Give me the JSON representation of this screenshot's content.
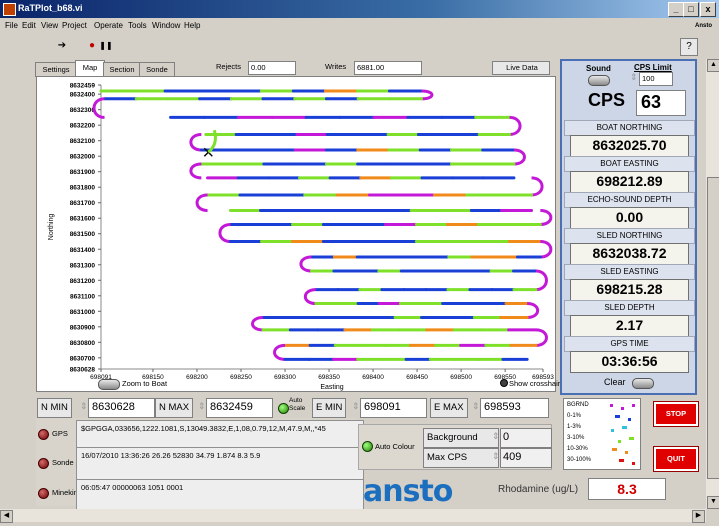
{
  "window": {
    "title": "RaTPlot_b68.vi",
    "min_glyph": "_",
    "max_glyph": "□",
    "close_glyph": "x"
  },
  "menu": {
    "file": "File",
    "edit": "Edit",
    "view": "View",
    "project": "Project",
    "operate": "Operate",
    "tools": "Tools",
    "window": "Window",
    "help": "Help",
    "right_label": "Ansto"
  },
  "toolbar": {
    "run_glyph": "➔",
    "stop_glyph": "●",
    "pause_glyph": "❚❚",
    "help_glyph": "?"
  },
  "tabs": [
    "Settings",
    "Map",
    "Section",
    "Sonde"
  ],
  "tab_active": 1,
  "top_fields": {
    "rejects_label": "Rejects",
    "rejects_value": "0.00",
    "writes_label": "Writes",
    "writes_value": "6881.00",
    "live_data": "Live Data"
  },
  "chart_data": {
    "type": "scatter",
    "ylabel": "Northing",
    "xlabel": "Easting",
    "xlim": [
      698091,
      698593
    ],
    "ylim": [
      8630628,
      8632459
    ],
    "x_ticks": [
      "698091",
      "698150",
      "698200",
      "698250",
      "698300",
      "698350",
      "698400",
      "698450",
      "698500",
      "698550",
      "698593"
    ],
    "y_ticks": [
      "8632459",
      "8632400",
      "8632300",
      "8632200",
      "8632100",
      "8632000",
      "8631900",
      "8631800",
      "8631700",
      "8631600",
      "8631500",
      "8631400",
      "8631300",
      "8631200",
      "8631100",
      "8631000",
      "8630900",
      "8630800",
      "8630700",
      "8630628"
    ],
    "color_scale": [
      "#1a3fd6",
      "#7fe02a",
      "#f08a1a",
      "#c418d8"
    ],
    "track_rows": [
      {
        "y": 8632420,
        "x0": 698091,
        "x1": 698455
      },
      {
        "y": 8632370,
        "x0": 698095,
        "x1": 698455
      },
      {
        "y": 8632250,
        "x0": 698170,
        "x1": 698555
      },
      {
        "y": 8632140,
        "x0": 698210,
        "x1": 698555
      },
      {
        "y": 8632040,
        "x0": 698205,
        "x1": 698560
      },
      {
        "y": 8631950,
        "x0": 698205,
        "x1": 698560
      },
      {
        "y": 8631860,
        "x0": 698212,
        "x1": 698560
      },
      {
        "y": 8631750,
        "x0": 698212,
        "x1": 698580
      },
      {
        "y": 8631650,
        "x0": 698238,
        "x1": 698580
      },
      {
        "y": 8631560,
        "x0": 698238,
        "x1": 698590
      },
      {
        "y": 8631450,
        "x0": 698238,
        "x1": 698590
      },
      {
        "y": 8631350,
        "x0": 698330,
        "x1": 698590
      },
      {
        "y": 8631260,
        "x0": 698330,
        "x1": 698585
      },
      {
        "y": 8631140,
        "x0": 698335,
        "x1": 698585
      },
      {
        "y": 8631050,
        "x0": 698335,
        "x1": 698575
      },
      {
        "y": 8630960,
        "x0": 698275,
        "x1": 698575
      },
      {
        "y": 8630880,
        "x0": 698275,
        "x1": 698585
      },
      {
        "y": 8630780,
        "x0": 698300,
        "x1": 698585
      },
      {
        "y": 8630690,
        "x0": 698300,
        "x1": 698575
      }
    ],
    "boat_position": {
      "x": 698212.89,
      "y": 8632025.7
    },
    "zoom_to_boat": "Zoom to Boat",
    "show_crosshair": "Show crosshair"
  },
  "limits": {
    "nmin_label": "N MIN",
    "nmin": "8630628",
    "nmax_label": "N MAX",
    "nmax": "8632459",
    "auto_scale": "Auto\nScale",
    "emin_label": "E MIN",
    "emin": "698091",
    "emax_label": "E MAX",
    "emax": "698593"
  },
  "right_panel": {
    "sound_label": "Sound",
    "cps_limit_label": "CPS Limit",
    "cps_limit_value": "100",
    "cps_label": "CPS",
    "cps_value": "63",
    "boat_northing_label": "BOAT NORTHING",
    "boat_northing": "8632025.70",
    "boat_easting_label": "BOAT EASTING",
    "boat_easting": "698212.89",
    "echo_label": "ECHO-SOUND DEPTH",
    "echo": "0.00",
    "sled_northing_label": "SLED NORTHING",
    "sled_northing": "8632038.72",
    "sled_easting_label": "SLED EASTING",
    "sled_easting": "698215.28",
    "sled_depth_label": "SLED DEPTH",
    "sled_depth": "2.17",
    "gps_time_label": "GPS TIME",
    "gps_time": "03:36:56",
    "clear_label": "Clear"
  },
  "logs": {
    "gps_label": "GPS",
    "gps": "$GPGGA,033656,1222.1081,S,13049.3832,E,1,08,0.79,12,M,47.9,M,,*45",
    "sonde_label": "Sonde",
    "sonde": "16/07/2010 13:36:26 26.26 52830 34.79  1.874    8.3   5.9",
    "minekin_label": "Minekin",
    "minekin": "06:05:47 00000063 1051 0001"
  },
  "colour": {
    "auto_colour": "Auto Colour",
    "background_label": "Background",
    "background_value": "0",
    "maxcps_label": "Max CPS",
    "maxcps_value": "409"
  },
  "legend": {
    "items": [
      "BGRND",
      "0-1%",
      "1-3%",
      "3-10%",
      "10-30%",
      "30-100%"
    ],
    "colors": [
      "#c418d8",
      "#1a3fd6",
      "#30c0e0",
      "#7fe02a",
      "#f08a1a",
      "#e01010"
    ]
  },
  "buttons": {
    "stop": "STOP",
    "quit": "QUIT"
  },
  "logo": "ansto",
  "rhodamine": {
    "label": "Rhodamine (ug/L)",
    "value": "8.3"
  }
}
